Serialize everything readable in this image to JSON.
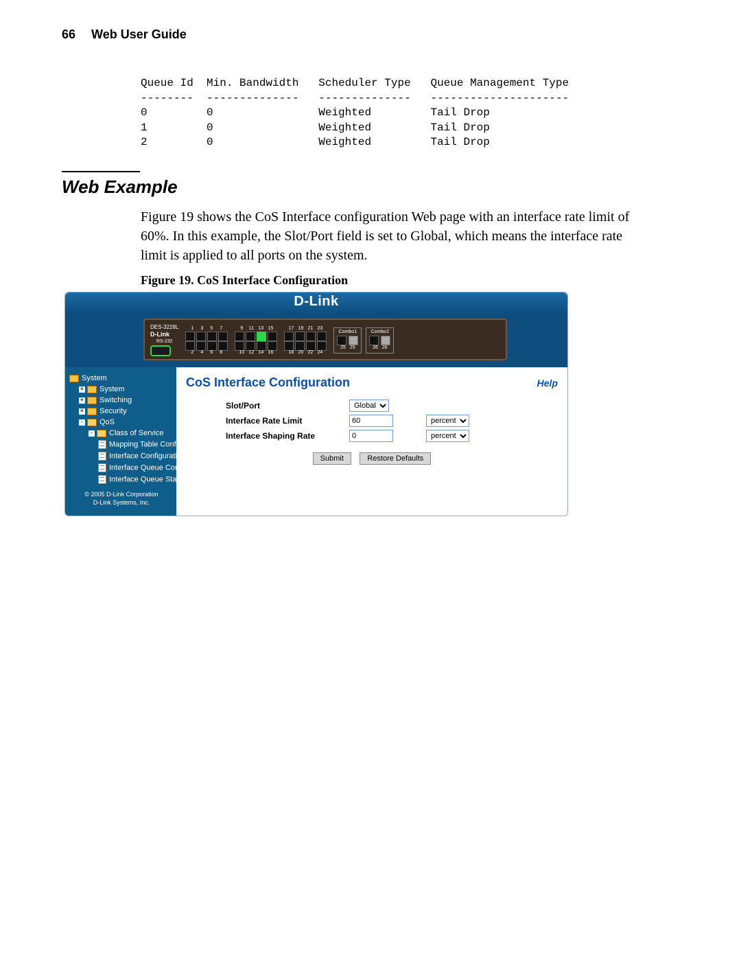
{
  "page_header": {
    "number": "66",
    "title": "Web User Guide"
  },
  "queue_table": {
    "headers": [
      "Queue Id",
      "Min. Bandwidth",
      "Scheduler Type",
      "Queue Management Type"
    ],
    "separators": [
      "--------",
      "--------------",
      "--------------",
      "---------------------"
    ],
    "rows": [
      [
        "0",
        "0",
        "Weighted",
        "Tail Drop"
      ],
      [
        "1",
        "0",
        "Weighted",
        "Tail Drop"
      ],
      [
        "2",
        "0",
        "Weighted",
        "Tail Drop"
      ]
    ]
  },
  "section_title": "Web Example",
  "body_paragraph": "Figure 19 shows the CoS Interface configuration Web page with an interface rate limit of 60%. In this example, the Slot/Port field is set to Global, which means the interface rate limit is applied to all ports on the system.",
  "figure_caption": {
    "lead": "Figure 19. ",
    "rest": "CoS Interface Configuration"
  },
  "screenshot": {
    "banner_brand": "D-Link",
    "device": {
      "model_line1": "DES-3228L",
      "model_line2": "D-Link",
      "rs_label": "RS-232",
      "port_groups": [
        {
          "top": [
            "1",
            "3",
            "5",
            "7"
          ],
          "bottom": [
            "2",
            "4",
            "6",
            "8"
          ]
        },
        {
          "top": [
            "9",
            "11",
            "13",
            "15"
          ],
          "bottom": [
            "10",
            "12",
            "14",
            "16"
          ],
          "lit_top_index": 2
        },
        {
          "top": [
            "17",
            "19",
            "21",
            "23"
          ],
          "bottom": [
            "18",
            "20",
            "22",
            "24"
          ]
        }
      ],
      "combos": [
        {
          "label": "Combo1",
          "nums": [
            "25",
            "25"
          ]
        },
        {
          "label": "Combo2",
          "nums": [
            "26",
            "26"
          ]
        }
      ]
    },
    "nav": {
      "items": [
        {
          "level": 1,
          "icon": "folder-closed",
          "pm": "",
          "label": "System"
        },
        {
          "level": 2,
          "icon": "folder-closed",
          "pm": "+",
          "label": "System"
        },
        {
          "level": 2,
          "icon": "folder-closed",
          "pm": "+",
          "label": "Switching"
        },
        {
          "level": 2,
          "icon": "folder-closed",
          "pm": "+",
          "label": "Security"
        },
        {
          "level": 2,
          "icon": "folder-open",
          "pm": "-",
          "label": "QoS"
        },
        {
          "level": 3,
          "icon": "folder-open",
          "pm": "-",
          "label": "Class of Service"
        },
        {
          "level": 4,
          "icon": "doc",
          "pm": "",
          "label": "Mapping Table Configu"
        },
        {
          "level": 4,
          "icon": "doc",
          "pm": "",
          "label": "Interface Configuration"
        },
        {
          "level": 4,
          "icon": "doc",
          "pm": "",
          "label": "Interface Queue Config"
        },
        {
          "level": 4,
          "icon": "doc",
          "pm": "",
          "label": "Interface Queue Status"
        }
      ],
      "copyright_line1": "© 2005 D-Link Corporation",
      "copyright_line2": "D-Link Systems, Inc."
    },
    "content": {
      "title": "CoS Interface Configuration",
      "help": "Help",
      "fields": {
        "slot_port": {
          "label": "Slot/Port",
          "value": "Global"
        },
        "rate_limit": {
          "label": "Interface Rate Limit",
          "value": "60",
          "unit": "percent"
        },
        "shaping_rate": {
          "label": "Interface Shaping Rate",
          "value": "0",
          "unit": "percent"
        }
      },
      "buttons": {
        "submit": "Submit",
        "restore": "Restore Defaults"
      }
    }
  }
}
